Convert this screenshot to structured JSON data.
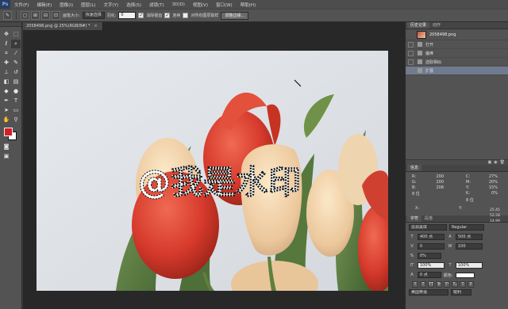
{
  "menubar": {
    "logo": "Ps",
    "items": [
      "文件(F)",
      "编辑(E)",
      "图像(I)",
      "图层(L)",
      "文字(Y)",
      "选择(S)",
      "滤镜(T)",
      "3D(D)",
      "视图(V)",
      "窗口(W)",
      "帮助(H)"
    ]
  },
  "options": {
    "feather_label": "羽化:",
    "feather_value": "0",
    "antialias_label": "消除锯齿",
    "brush_size_label": "画笔大小:",
    "brush_mode": "快速选择",
    "contiguous_label": "连续",
    "sample_all_label": "对所有图层取样",
    "refine_edge_button": "调整边缘..."
  },
  "document": {
    "tab_title": "2058498.png @ 25%(RGB/8#) *",
    "tab_close": "×",
    "watermark_text": "@我是水印"
  },
  "colors": {
    "foreground": "#d41f26",
    "background": "#ffffff",
    "history_selected": "#6f7b8f",
    "selection_outline": "#111111"
  },
  "history_panel": {
    "tabs": [
      "历史记录",
      "动作"
    ],
    "snapshot": "2058498.png",
    "items": [
      {
        "label": "打开",
        "selected": false
      },
      {
        "label": "魔棒",
        "selected": false
      },
      {
        "label": "选取相似",
        "selected": false
      },
      {
        "label": "扩展",
        "selected": true
      }
    ]
  },
  "info_panel": {
    "tabs": [
      "信息"
    ],
    "rgb": [
      {
        "label": "R:",
        "value": "200"
      },
      {
        "label": "G:",
        "value": "200"
      },
      {
        "label": "B:",
        "value": "208"
      }
    ],
    "bit_left": "8 位",
    "cmyk": [
      {
        "label": "C:",
        "value": "27%"
      },
      {
        "label": "M:",
        "value": "20%"
      },
      {
        "label": "Y:",
        "value": "15%"
      },
      {
        "label": "K:",
        "value": "0%"
      }
    ],
    "bit_right": "8 位",
    "x_label": "X:",
    "y_label": "Y:"
  },
  "character_panel": {
    "tabs": [
      "字符",
      "段落"
    ],
    "font_family": "思源黑体",
    "font_style": "Regular",
    "size": "400 点",
    "leading": "500 点",
    "kerning": "0",
    "tracking": "100",
    "scale_pct": "0%",
    "v_scale": "100%",
    "h_scale": "100%",
    "baseline": "0 点",
    "color_label": "颜色:",
    "format_buttons": [
      "T",
      "T",
      "TT",
      "Tr",
      "T¹",
      "T₁",
      "T",
      "Ŧ"
    ],
    "language": "美国英语",
    "aa_mode": "锐利"
  },
  "far_right_values": [
    "25.45",
    "52.28",
    "14.99"
  ]
}
